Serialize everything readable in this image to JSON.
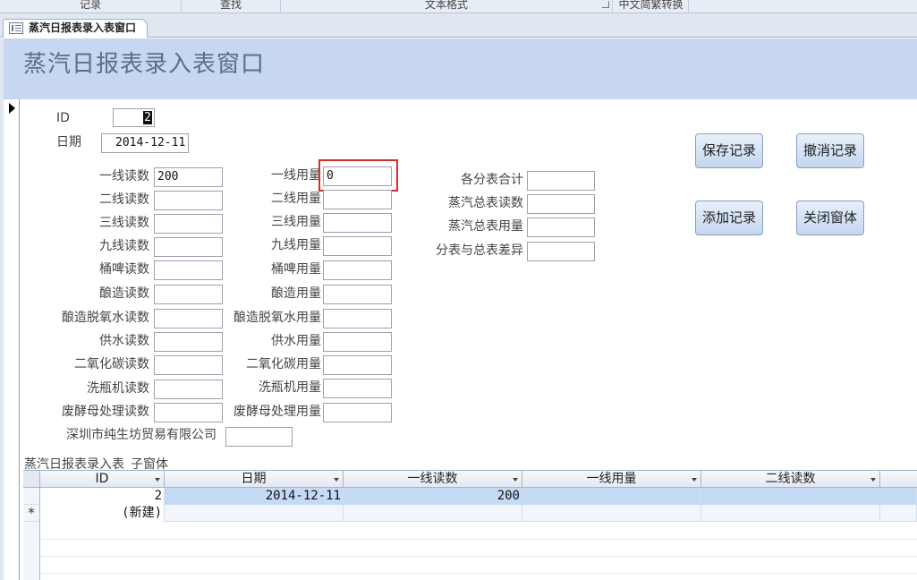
{
  "ribbon": {
    "groups": [
      "记录",
      "查找",
      "文本格式",
      "中文简繁转换"
    ]
  },
  "tab": {
    "label": "蒸汽日报表录入表窗口"
  },
  "form": {
    "title": "蒸汽日报表录入表窗口",
    "id_label": "ID",
    "id_value": "2",
    "date_label": "日期",
    "date_value": "2014-12-11",
    "left_fields": [
      {
        "label": "一线读数",
        "value": "200"
      },
      {
        "label": "二线读数",
        "value": ""
      },
      {
        "label": "三线读数",
        "value": ""
      },
      {
        "label": "九线读数",
        "value": ""
      },
      {
        "label": "桶啤读数",
        "value": ""
      },
      {
        "label": "酿造读数",
        "value": ""
      },
      {
        "label": "酿造脱氧水读数",
        "value": ""
      },
      {
        "label": "供水读数",
        "value": ""
      },
      {
        "label": "二氧化碳读数",
        "value": ""
      },
      {
        "label": "洗瓶机读数",
        "value": ""
      },
      {
        "label": "废酵母处理读数",
        "value": ""
      }
    ],
    "mid_fields": [
      {
        "label": "一线用量",
        "value": "0"
      },
      {
        "label": "二线用量",
        "value": ""
      },
      {
        "label": "三线用量",
        "value": ""
      },
      {
        "label": "九线用量",
        "value": ""
      },
      {
        "label": "桶啤用量",
        "value": ""
      },
      {
        "label": "酿造用量",
        "value": ""
      },
      {
        "label": "酿造脱氧水用量",
        "value": ""
      },
      {
        "label": "供水用量",
        "value": ""
      },
      {
        "label": "二氧化碳用量",
        "value": ""
      },
      {
        "label": "洗瓶机用量",
        "value": ""
      },
      {
        "label": "废酵母处理用量",
        "value": ""
      }
    ],
    "company_label": "深圳市纯生坊贸易有限公司",
    "company_value": "",
    "right_fields": [
      {
        "label": "各分表合计",
        "value": ""
      },
      {
        "label": "蒸汽总表读数",
        "value": ""
      },
      {
        "label": "蒸汽总表用量",
        "value": ""
      },
      {
        "label": "分表与总表差异",
        "value": ""
      }
    ],
    "buttons": {
      "save": "保存记录",
      "undo": "撤消记录",
      "add": "添加记录",
      "close": "关闭窗体"
    }
  },
  "subform": {
    "caption": "蒸汽日报表录入表_子窗体",
    "columns": [
      "ID",
      "日期",
      "一线读数",
      "一线用量",
      "二线读数",
      "二"
    ],
    "rows": [
      {
        "selector": "",
        "cells": [
          "2",
          "2014-12-11",
          "200",
          "",
          "",
          ""
        ]
      },
      {
        "selector": "*",
        "cells": [
          "(新建)",
          "",
          "",
          "",
          "",
          ""
        ]
      }
    ]
  }
}
